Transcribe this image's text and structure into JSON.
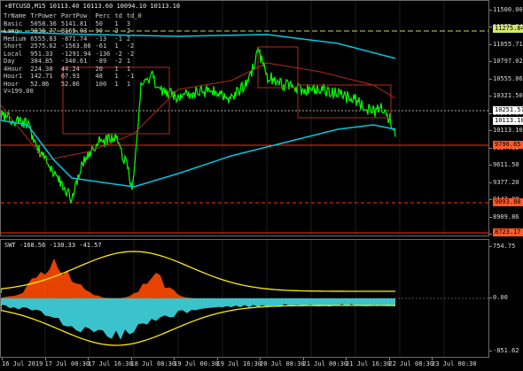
{
  "header": {
    "symbol": "BTCUSD,M15",
    "ohlc": "10113.40 10113.60 10094.10 10113.10"
  },
  "stats_table": {
    "columns": [
      "TrName",
      "TrPower",
      "PartPow",
      "Perc",
      "td",
      "td_0"
    ],
    "rows": [
      [
        "Basic",
        "5058.36",
        "5141.81",
        "50",
        "1",
        "3"
      ],
      [
        "Long",
        "9036.77",
        "8165.03",
        "90",
        "2",
        "2"
      ],
      [
        "Medium",
        "6555.83",
        "-871.74",
        "-13",
        "-1",
        "2"
      ],
      [
        "Short",
        "2575.62",
        "-1563.86",
        "-61",
        "1",
        "-2"
      ],
      [
        "Local",
        "951.33",
        "-1291.94",
        "-136",
        "-2",
        "-2"
      ],
      [
        "Day",
        "384.85",
        "-340.61",
        "-89",
        "-2",
        "1"
      ],
      [
        "4Hour",
        "224.38",
        "44.24",
        "20",
        "1",
        "1"
      ],
      [
        "Hour1",
        "142.71",
        "67.93",
        "48",
        "1",
        "-1"
      ],
      [
        "Hour",
        "52.86",
        "52.86",
        "100",
        "1",
        "1"
      ]
    ],
    "volume_label": "V=199.00"
  },
  "price_scale": {
    "ticks": [
      "11500.00",
      "11275.84",
      "11055.71",
      "10797.02",
      "10555.06",
      "10321.50",
      "10251.57",
      "10113.10",
      "9857.65",
      "9611.50",
      "9377.20",
      "9143.00",
      "8909.86",
      "8676.30"
    ],
    "tags": [
      {
        "label": "11275.84",
        "color": "#d4e86a"
      },
      {
        "label": "10251.57",
        "color": "#ffffff"
      },
      {
        "label": "10113.10",
        "color": "#ffffff"
      },
      {
        "label": "9796.65",
        "color": "#ff5a2a"
      },
      {
        "label": "9093.88",
        "color": "#ff5a2a"
      },
      {
        "label": "8723.17",
        "color": "#ff5a2a"
      }
    ]
  },
  "sub_panel": {
    "label": "SWT -168.56 -130.33 -41.57",
    "ticks": [
      "754.75",
      "0.00",
      "-851.62"
    ]
  },
  "time_axis": [
    "16 Jul 2019",
    "17 Jul 00:30",
    "17 Jul 16:30",
    "18 Jul 08:30",
    "19 Jul 00:30",
    "19 Jul 16:30",
    "20 Jul 08:30",
    "21 Jul 00:30",
    "21 Jul 16:30",
    "22 Jul 08:30",
    "23 Jul 00:30"
  ],
  "colors": {
    "candles": "#00ff00",
    "ma_fast": "#00c8e0",
    "ma_slow": "#b22a1a",
    "level_yellow": "#c8d850",
    "level_red": "#ff3000",
    "osc_orange": "#ff4a00",
    "osc_cyan": "#40d8e0",
    "osc_yellow": "#ffee00"
  }
}
